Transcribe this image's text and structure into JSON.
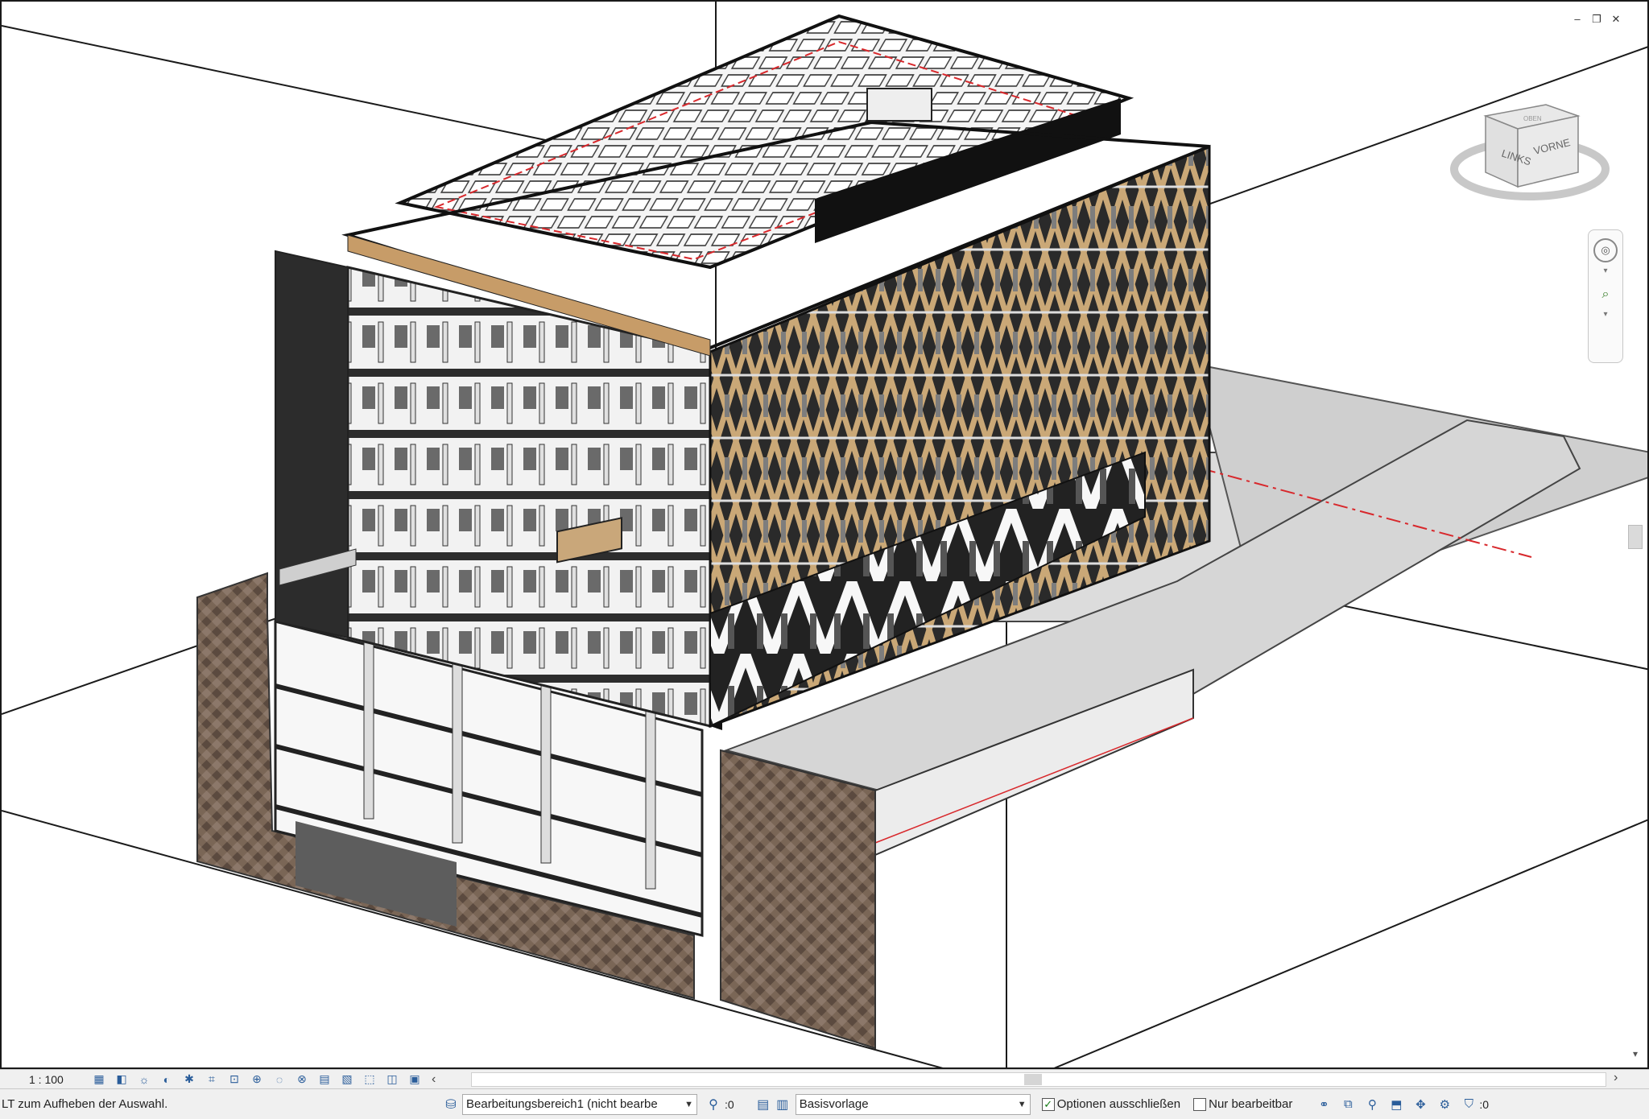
{
  "window": {
    "controls": {
      "minimize": "–",
      "restore": "❐",
      "close": "✕"
    }
  },
  "viewcube": {
    "face_left": "LINKS",
    "face_right": "VORNE",
    "top_label": "OBEN"
  },
  "navbar": {
    "wheel_icon": "steering-wheel-icon",
    "zoom_icon": "zoom-region-icon"
  },
  "view_control_bar": {
    "scale": "1 : 100",
    "icons": [
      "detail-level-icon",
      "visual-style-icon",
      "sun-path-icon",
      "shadows-icon",
      "render-dialog-icon",
      "crop-view-icon",
      "show-crop-region-icon",
      "unlock-3d-view-icon",
      "temporary-hide-icon",
      "reveal-hidden-icon",
      "temporary-view-properties-icon",
      "analysis-display-icon",
      "highlight-displacement-icon",
      "reveal-constraints-icon",
      "worksharing-display-icon"
    ],
    "collapse_arrow": "‹",
    "scroll_right_arrow": "›"
  },
  "status_bar": {
    "message": "LT zum Aufheben der Auswahl.",
    "worksets_icon": "worksets-icon",
    "workset": "Bearbeitungsbereich1 (nicht bearbe",
    "editable_only_count": ":0",
    "design_options_icon": "design-options-icon",
    "main_model_icon": "main-model-icon",
    "design_option": "Basisvorlage",
    "exclude_options_label": "Optionen ausschließen",
    "exclude_options_checked": true,
    "editable_only_label": "Nur bearbeitbar",
    "editable_only_checked": false,
    "selection_tools": [
      "select-links-icon",
      "select-underlay-icon",
      "select-pinned-icon",
      "select-by-face-icon",
      "drag-on-selection-icon",
      "background-processes-icon"
    ],
    "filter_count": ":0"
  },
  "colors": {
    "soil_hatch": "#6e5a4e",
    "timber": "#c9a77a",
    "glazing": "#2b2b2b",
    "section_line": "#d8282c",
    "ground": "#d8d8d8"
  }
}
